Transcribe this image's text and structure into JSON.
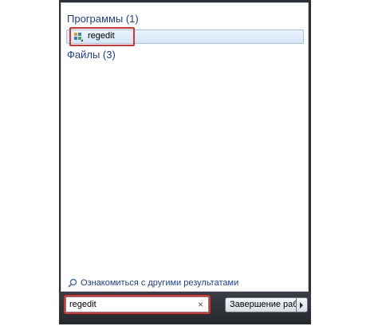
{
  "results": {
    "programs_header": "Программы (1)",
    "program_item_label": "regedit",
    "files_header": "Файлы (3)",
    "more_results_link": "Ознакомиться с другими результатами"
  },
  "search": {
    "value": "regedit",
    "clear_glyph": "×"
  },
  "shutdown": {
    "label": "Завершение раб"
  },
  "icons": {
    "program": "regedit-icon",
    "more_results": "search-icon",
    "clear": "close-icon",
    "shutdown_options": "chevron-right-icon"
  },
  "colors": {
    "group_header": "#1d3f91",
    "highlight": "#e0322c",
    "selected_item": "#d6e7f8"
  }
}
